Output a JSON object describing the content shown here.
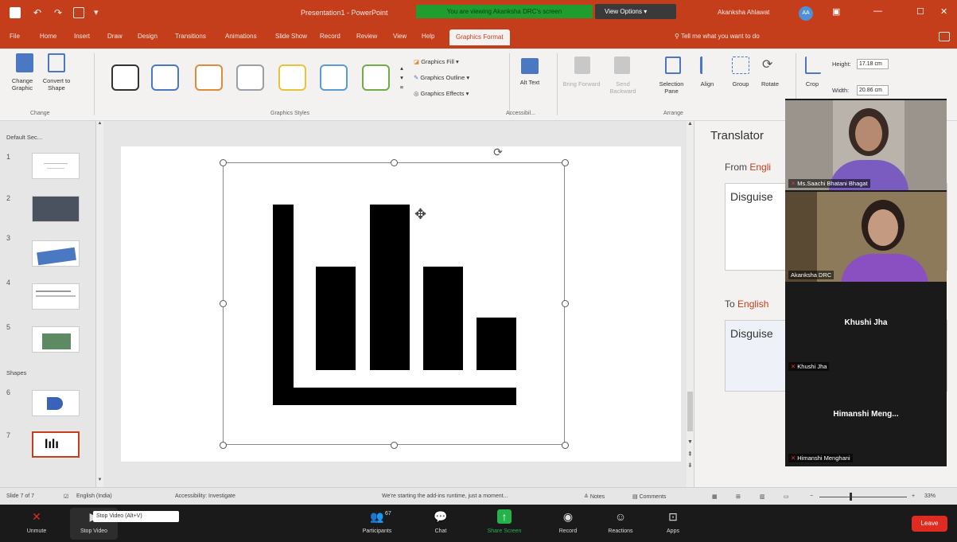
{
  "titlebar": {
    "doc_title": "Presentation1 - PowerPoint",
    "banner": "You are viewing Akanksha DRC's screen",
    "view_options": "View Options",
    "user_name": "Akanksha Ahlawat",
    "user_initials": "AA"
  },
  "tabs": [
    {
      "label": "File"
    },
    {
      "label": "Home"
    },
    {
      "label": "Insert"
    },
    {
      "label": "Draw"
    },
    {
      "label": "Design"
    },
    {
      "label": "Transitions"
    },
    {
      "label": "Animations"
    },
    {
      "label": "Slide Show"
    },
    {
      "label": "Record"
    },
    {
      "label": "Review"
    },
    {
      "label": "View"
    },
    {
      "label": "Help"
    },
    {
      "label": "Graphics Format"
    }
  ],
  "tell_me": "Tell me what you want to do",
  "ribbon": {
    "change_graphic": "Change Graphic",
    "convert_to_shape": "Convert to Shape",
    "group_change": "Change",
    "group_styles": "Graphics Styles",
    "graphics_fill": "Graphics Fill",
    "graphics_outline": "Graphics Outline",
    "graphics_effects": "Graphics Effects",
    "alt_text": "Alt Text",
    "group_accessibility": "Accessibil...",
    "bring_forward": "Bring Forward",
    "send_backward": "Send Backward",
    "selection_pane": "Selection Pane",
    "align": "Align",
    "group": "Group",
    "rotate": "Rotate",
    "group_arrange": "Arrange",
    "crop": "Crop",
    "height_label": "Height:",
    "height_value": "17.18 cm",
    "width_label": "Width:",
    "width_value": "20.86 cm",
    "style_colors": [
      "#333333",
      "#4a78c2",
      "#e08a3c",
      "#9aa0a6",
      "#e7c33a",
      "#5b9bd5",
      "#70ad47"
    ]
  },
  "slide_pane": {
    "section_default": "Default Sec...",
    "section_shapes": "Shapes",
    "slides": [
      {
        "num": "1"
      },
      {
        "num": "2"
      },
      {
        "num": "3"
      },
      {
        "num": "4"
      },
      {
        "num": "5"
      },
      {
        "num": "6"
      },
      {
        "num": "7"
      }
    ]
  },
  "translator": {
    "title": "Translator",
    "from_label": "From",
    "from_lang": "Engli",
    "to_label": "To",
    "to_lang": "English",
    "source_text": "Disguise",
    "target_text": "Disguise"
  },
  "participants": [
    {
      "name": "Ms.Saachi Bhatani Bhagat",
      "type": "video"
    },
    {
      "name": "Akanksha DRC",
      "type": "video"
    },
    {
      "name": "Khushi Jha",
      "display": "Khushi Jha",
      "type": "name"
    },
    {
      "name": "Himanshi Menghani",
      "display": "Himanshi Meng...",
      "type": "name"
    }
  ],
  "statusbar": {
    "slide_of": "Slide 7 of 7",
    "language": "English (India)",
    "accessibility": "Accessibility: Investigate",
    "notice": "We're starting the add-ins runtime, just a moment...",
    "notes": "Notes",
    "comments": "Comments",
    "zoom": "33%"
  },
  "zoom_toolbar": {
    "unmute": "Unmute",
    "stop_video": "Stop Video",
    "tooltip": "Stop Video (Alt+V)",
    "participants": "Participants",
    "participant_count": "67",
    "chat": "Chat",
    "share_screen": "Share Screen",
    "record": "Record",
    "reactions": "Reactions",
    "apps": "Apps",
    "leave": "Leave"
  }
}
